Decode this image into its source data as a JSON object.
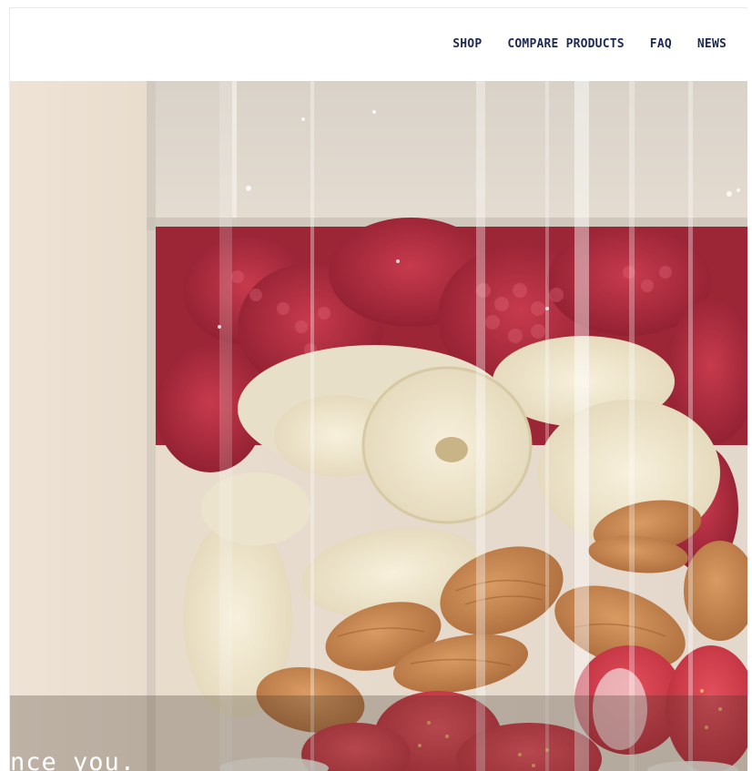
{
  "nav": {
    "items": [
      {
        "id": "shop",
        "label": "SHOP"
      },
      {
        "id": "compare-products",
        "label": "COMPARE PRODUCTS"
      },
      {
        "id": "faq",
        "label": "FAQ"
      },
      {
        "id": "news",
        "label": "NEWS"
      }
    ]
  },
  "hero": {
    "caption": "nce you.",
    "image_subject": "blender jar with raspberries, banana slices, almonds, strawberries"
  },
  "colors": {
    "nav_text": "#1d2a4f",
    "raspberry": "#b02a3e",
    "banana": "#efe6cf",
    "almond": "#c98b55",
    "strawberry": "#d8404e",
    "background_wall": "#e9ddd0"
  }
}
